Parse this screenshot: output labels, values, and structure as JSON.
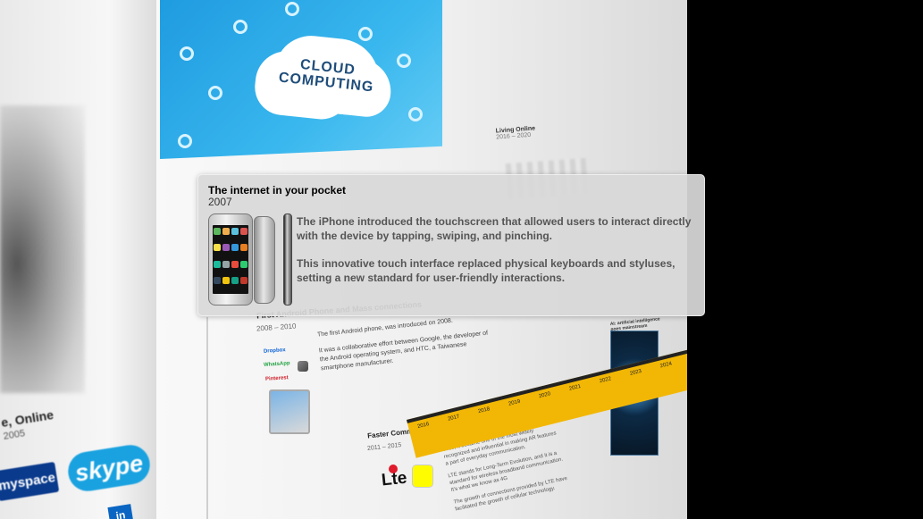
{
  "popover": {
    "title": "The internet in your pocket",
    "year": "2007",
    "paragraph_1": "The iPhone introduced the touchscreen that allowed users to interact directly with the device by tapping, swiping, and pinching.",
    "paragraph_2": "This innovative touch interface replaced physical keyboards and styluses, setting a new standard for user-friendly interactions.",
    "image_icon": "iphone-image"
  },
  "background": {
    "cloud_line_1": "CLOUD",
    "cloud_line_2": "COMPUTING",
    "left_section_title": "e, Online",
    "left_section_years": "2005",
    "myspace_label": "myspace",
    "skype_label": "skype",
    "linkedin_label": "in",
    "living_online_title": "Living Online",
    "living_online_years": "2016 – 2020",
    "android_title": "First Android Phone and Mass connections",
    "android_years": "2008 – 2010",
    "android_text_1": "The first Android phone, was introduced on 2008.",
    "android_text_2": "It was a collaborative effort between Google, the developer of the Android operating system, and HTC, a Taiwanese smartphone manufacturer.",
    "dropbox_label": "Dropbox",
    "whatsapp_label": "WhatsApp",
    "pinterest_label": "Pinterest",
    "faster_title": "Faster Communication - AR",
    "faster_years": "2011 – 2015",
    "faster_text_1": "Snapchat might not have been the first app to use AR, but with the introduction of the filters in 2015, it became one of the most widely recognized and influential in making AR features a part of everyday communication.",
    "faster_text_2": "LTE stands for Long-Term Evolution, and it is a standard for wireless broadband communication. It's what we know as 4G",
    "faster_text_3": "The growth of connections provided by LTE have facilitated the growth of cellular technology.",
    "lte_label": "Lte",
    "ai_title": "AI: artificial intelligence goes mainstream",
    "timeline_years": [
      "2016",
      "2017",
      "2018",
      "2019",
      "2020",
      "2021",
      "2022",
      "2023",
      "2024"
    ]
  },
  "colors": {
    "cloud_banner": "#1f9be0",
    "timeline_bar": "#f2b705",
    "card_background": "#d8d8d8"
  }
}
